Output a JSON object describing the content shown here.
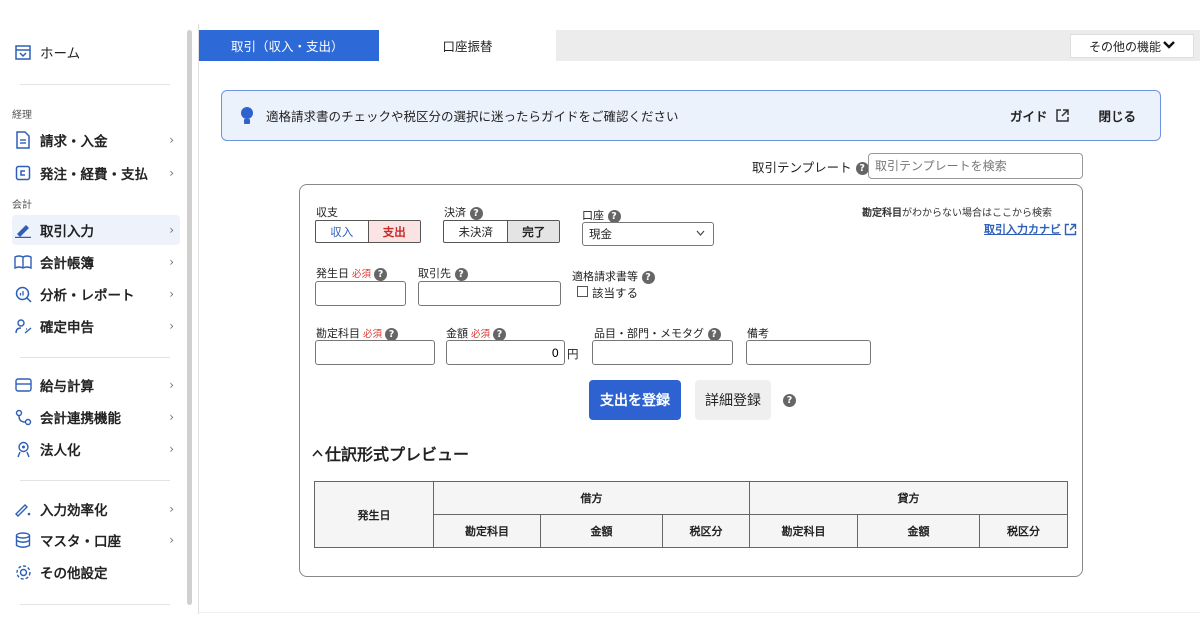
{
  "sidebar": {
    "home": "ホーム",
    "section_accounting": "経理",
    "section_books": "会計",
    "items": [
      {
        "label": "請求・入金",
        "icon": "document-icon"
      },
      {
        "label": "発注・経費・支払",
        "icon": "receipt-icon"
      },
      {
        "label": "取引入力",
        "icon": "pen-icon"
      },
      {
        "label": "会計帳簿",
        "icon": "book-icon"
      },
      {
        "label": "分析・レポート",
        "icon": "magnifier-icon"
      },
      {
        "label": "確定申告",
        "icon": "tax-return-icon"
      },
      {
        "label": "給与計算",
        "icon": "card-icon"
      },
      {
        "label": "会計連携機能",
        "icon": "link-icon"
      },
      {
        "label": "法人化",
        "icon": "corporation-icon"
      },
      {
        "label": "入力効率化",
        "icon": "magic-pen-icon"
      },
      {
        "label": "マスタ・口座",
        "icon": "database-icon"
      },
      {
        "label": "その他設定",
        "icon": "gear-icon"
      }
    ],
    "chevron": "›"
  },
  "tabs": {
    "active": "取引（収入・支出）",
    "second": "口座振替",
    "more": "その他の機能",
    "more_caret": "❯"
  },
  "banner": {
    "text": "適格請求書のチェックや税区分の選択に迷ったらガイドをご確認ください",
    "guide": "ガイド",
    "close": "閉じる"
  },
  "template": {
    "label": "取引テンプレート",
    "placeholder": "取引テンプレートを検索"
  },
  "help_mark": "?",
  "form": {
    "income_expense_label": "収支",
    "income": "収入",
    "expense": "支出",
    "settlement_label": "決済",
    "unsettled": "未決済",
    "settled": "完了",
    "account_label": "口座",
    "account_value": "現金",
    "account_caret": "⌄",
    "hint_bold": "勘定科目",
    "hint_rest": "がわからない場合はここから検索",
    "navi_link": "取引入力カナビ",
    "date_label": "発生日",
    "required": "必須",
    "partner_label": "取引先",
    "invoice_label": "適格請求書等",
    "invoice_check": "該当する",
    "account_item_label": "勘定科目",
    "amount_label": "金額",
    "amount_value": "0",
    "currency": "円",
    "tags_label": "品目・部門・メモタグ",
    "memo_label": "備考",
    "submit": "支出を登録",
    "detail": "詳細登録"
  },
  "preview": {
    "title": "仕訳形式プレビュー",
    "collapse_icon": "^",
    "date_col": "発生日",
    "debit": "借方",
    "credit": "貸方",
    "sub_cols": [
      "勘定科目",
      "金額",
      "税区分"
    ]
  }
}
